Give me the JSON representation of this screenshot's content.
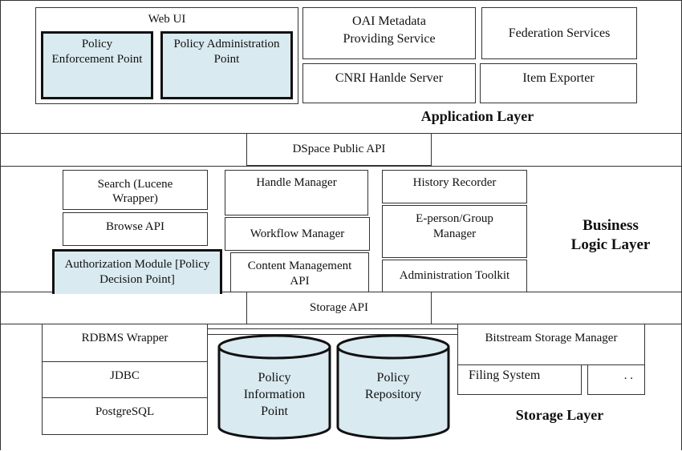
{
  "application_layer": {
    "label": "Application Layer",
    "web_ui": {
      "title": "Web UI",
      "pep": "Policy Enforcement Point",
      "pap": "Policy Administration Point"
    },
    "oai": "OAI Metadata Providing Service",
    "federation": "Federation Services",
    "cnri": "CNRI Hanlde Server",
    "item_exporter": "Item Exporter"
  },
  "public_api": "DSpace Public API",
  "business_layer": {
    "label_line1": "Business",
    "label_line2": "Logic Layer",
    "search": "Search (Lucene Wrapper)",
    "browse": "Browse API",
    "auth": "Authorization Module [Policy Decision Point]",
    "handle": "Handle Manager",
    "workflow": "Workflow Manager",
    "content": "Content Management API",
    "history": "History Recorder",
    "eperson": "E-person/Group Manager",
    "admin": "Administration Toolkit"
  },
  "storage_api": "Storage API",
  "storage_layer": {
    "label": "Storage Layer",
    "rdbms": "RDBMS Wrapper",
    "jdbc": "JDBC",
    "postgres": "PostgreSQL",
    "pip": "Policy Information Point",
    "repo": "Policy Repository",
    "bitstream": "Bitstream Storage Manager",
    "filing": "Filing System",
    "other": ". ."
  },
  "colors": {
    "policy_fill": "#d9eaf0",
    "line": "#333333"
  }
}
